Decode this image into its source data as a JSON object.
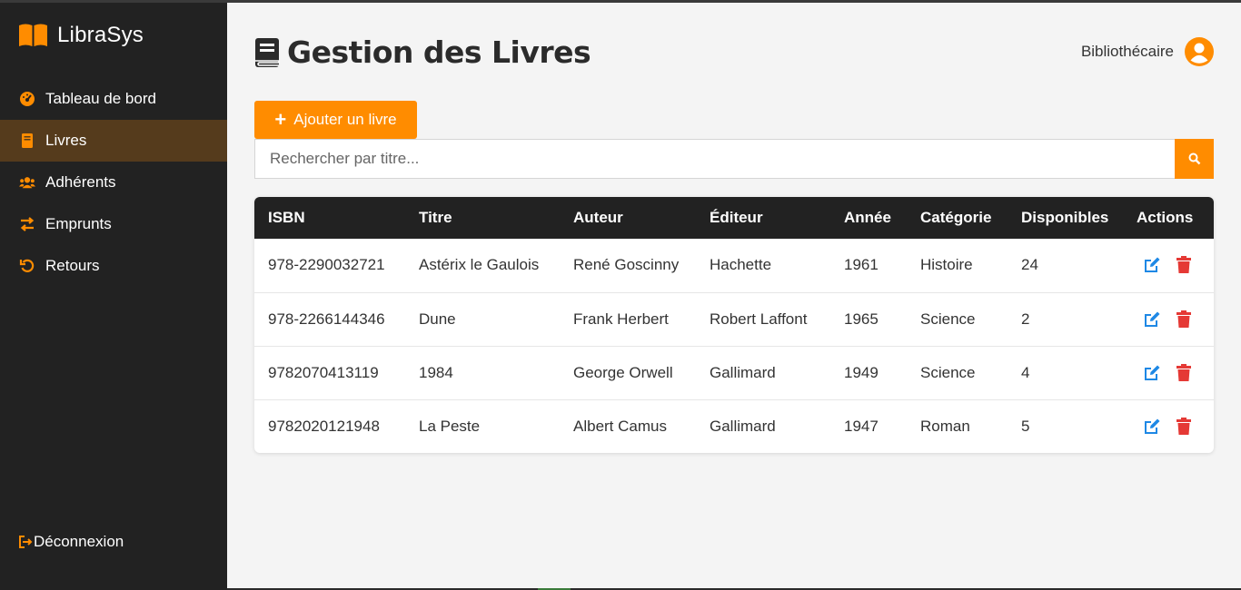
{
  "app": {
    "name": "LibraSys"
  },
  "colors": {
    "accent": "#ff8c00",
    "sidebar": "#222222",
    "active": "#553b1c",
    "edit": "#1e88e5",
    "delete": "#e53935"
  },
  "sidebar": {
    "items": [
      {
        "label": "Tableau de bord",
        "icon": "dashboard-gauge-icon"
      },
      {
        "label": "Livres",
        "icon": "book-icon",
        "active": true
      },
      {
        "label": "Adhérents",
        "icon": "users-icon"
      },
      {
        "label": "Emprunts",
        "icon": "exchange-arrows-icon"
      },
      {
        "label": "Retours",
        "icon": "undo-icon"
      }
    ],
    "logout": "Déconnexion"
  },
  "header": {
    "title": "Gestion des Livres",
    "user": "Bibliothécaire"
  },
  "toolbar": {
    "add_label": "Ajouter un livre",
    "search_placeholder": "Rechercher par titre..."
  },
  "table": {
    "columns": [
      "ISBN",
      "Titre",
      "Auteur",
      "Éditeur",
      "Année",
      "Catégorie",
      "Disponibles",
      "Actions"
    ],
    "rows": [
      [
        "978-2290032721",
        "Astérix le Gaulois",
        "René Goscinny",
        "Hachette",
        "1961",
        "Histoire",
        "24"
      ],
      [
        "978-2266144346",
        "Dune",
        "Frank Herbert",
        "Robert Laffont",
        "1965",
        "Science",
        "2"
      ],
      [
        "9782070413119",
        "1984",
        "George Orwell",
        "Gallimard",
        "1949",
        "Science",
        "4"
      ],
      [
        "9782020121948",
        "La Peste",
        "Albert Camus",
        "Gallimard",
        "1947",
        "Roman",
        "5"
      ]
    ]
  }
}
